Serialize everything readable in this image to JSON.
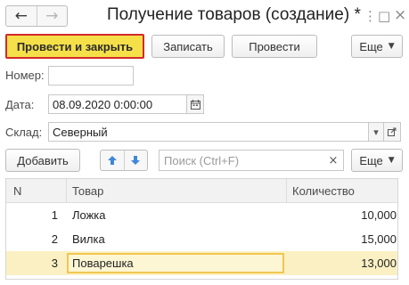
{
  "header": {
    "title": "Получение товаров (создание) *",
    "back_icon": "←",
    "forward_icon": "→",
    "more_icon": "⋮",
    "maximize_icon": "□",
    "close_icon": "×"
  },
  "commands": {
    "post_and_close": "Провести и закрыть",
    "save": "Записать",
    "post": "Провести",
    "more": "Еще"
  },
  "form": {
    "number_label": "Номер:",
    "number_value": "",
    "date_label": "Дата:",
    "date_value": "08.09.2020  0:00:00",
    "warehouse_label": "Склад:",
    "warehouse_value": "Северный"
  },
  "table_toolbar": {
    "add": "Добавить",
    "search_placeholder": "Поиск (Ctrl+F)",
    "clear_icon": "×",
    "more": "Еще"
  },
  "table": {
    "columns": [
      "N",
      "Товар",
      "Количество"
    ],
    "rows": [
      {
        "n": "1",
        "product": "Ложка",
        "qty": "10,000"
      },
      {
        "n": "2",
        "product": "Вилка",
        "qty": "15,000"
      },
      {
        "n": "3",
        "product": "Поварешка",
        "qty": "13,000"
      }
    ]
  },
  "colors": {
    "primary_button": "#f6e04a",
    "primary_border": "#d22a2a",
    "selected_row": "#fbf0c3",
    "arrow_blue": "#3f87d8"
  }
}
